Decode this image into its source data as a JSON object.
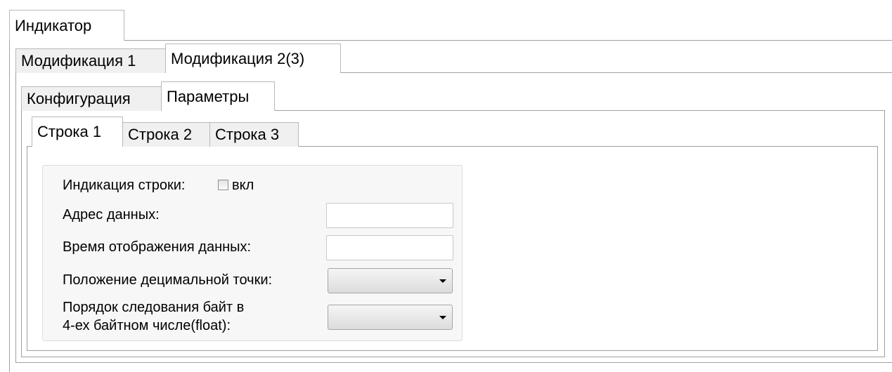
{
  "tabs_level1": [
    {
      "label": "Индикатор",
      "active": true
    }
  ],
  "tabs_level2": [
    {
      "label": "Модификация 1",
      "active": false
    },
    {
      "label": "Модификация 2(3)",
      "active": true
    }
  ],
  "tabs_level3": [
    {
      "label": "Конфигурация",
      "active": false
    },
    {
      "label": "Параметры",
      "active": true
    }
  ],
  "tabs_level4": [
    {
      "label": "Строка 1",
      "active": true
    },
    {
      "label": "Строка 2",
      "active": false
    },
    {
      "label": "Строка 3",
      "active": false
    }
  ],
  "form": {
    "line_indication_label": "Индикация строки:",
    "line_indication_checkbox_label": "вкл",
    "line_indication_checked": false,
    "data_address_label": "Адрес данных:",
    "data_address_value": "",
    "display_time_label": "Время отображения данных:",
    "display_time_value": "",
    "decimal_point_label": "Положение децимальной точки:",
    "decimal_point_value": "",
    "byte_order_label_line1": "Порядок следования байт в",
    "byte_order_label_line2": "4-ех байтном числе(float):",
    "byte_order_value": ""
  }
}
